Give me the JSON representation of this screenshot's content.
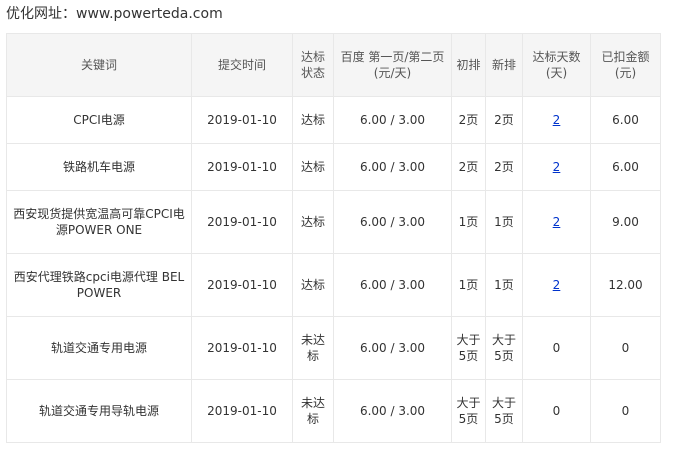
{
  "site": {
    "label": "优化网址：",
    "url": "www.powerteda.com"
  },
  "table": {
    "headers": {
      "keyword": "关键词",
      "submit_time": "提交时间",
      "status": "达标状态",
      "baidu_price": "百度 第一页/第二页(元/天)",
      "initial_rank": "初排",
      "new_rank": "新排",
      "days": "达标天数(天)",
      "deducted": "已扣金额(元)"
    },
    "rows": [
      {
        "keyword": "CPCI电源",
        "submit_time": "2019-01-10",
        "status": "达标",
        "price": "6.00 / 3.00",
        "initial_rank": "2页",
        "new_rank": "2页",
        "days": "2",
        "deducted": "6.00"
      },
      {
        "keyword": "铁路机车电源",
        "submit_time": "2019-01-10",
        "status": "达标",
        "price": "6.00 / 3.00",
        "initial_rank": "2页",
        "new_rank": "2页",
        "days": "2",
        "deducted": "6.00"
      },
      {
        "keyword": "西安现货提供宽温高可靠CPCI电源POWER ONE",
        "submit_time": "2019-01-10",
        "status": "达标",
        "price": "6.00 / 3.00",
        "initial_rank": "1页",
        "new_rank": "1页",
        "days": "2",
        "deducted": "9.00"
      },
      {
        "keyword": "西安代理铁路cpci电源代理 BEL POWER",
        "submit_time": "2019-01-10",
        "status": "达标",
        "price": "6.00 / 3.00",
        "initial_rank": "1页",
        "new_rank": "1页",
        "days": "2",
        "deducted": "12.00"
      },
      {
        "keyword": "轨道交通专用电源",
        "submit_time": "2019-01-10",
        "status": "未达标",
        "price": "6.00 / 3.00",
        "initial_rank": "大于5页",
        "new_rank": "大于5页",
        "days": "0",
        "deducted": "0"
      },
      {
        "keyword": "轨道交通专用导轨电源",
        "submit_time": "2019-01-10",
        "status": "未达标",
        "price": "6.00 / 3.00",
        "initial_rank": "大于5页",
        "new_rank": "大于5页",
        "days": "0",
        "deducted": "0"
      }
    ]
  },
  "colors": {
    "new_rank_highlight": "#e00000",
    "link": "#0033cc",
    "header_bg": "#f5f5f5",
    "border": "#e8e8e8"
  }
}
